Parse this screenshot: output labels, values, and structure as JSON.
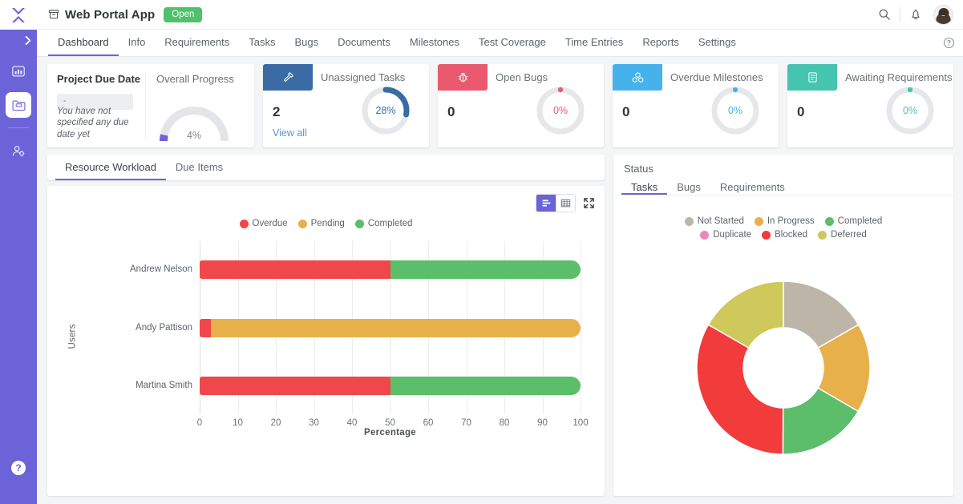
{
  "rail": {
    "logo_icon": "x-logo-icon",
    "expand_icon": "chevron-right-icon",
    "items": [
      {
        "icon": "dashboard-icon",
        "active": false
      },
      {
        "icon": "projects-folder-icon",
        "active": true
      },
      {
        "icon": "user-settings-icon",
        "active": false
      }
    ],
    "help_label": "?"
  },
  "topbar": {
    "project_icon": "archive-box-icon",
    "title": "Web Portal App",
    "status_badge": "Open",
    "search_icon": "search-icon",
    "bell_icon": "bell-icon",
    "avatar_icon": "user-avatar"
  },
  "nav": {
    "help_icon": "help-circle-icon",
    "tabs": [
      {
        "label": "Dashboard",
        "active": true
      },
      {
        "label": "Info",
        "active": false
      },
      {
        "label": "Requirements",
        "active": false
      },
      {
        "label": "Tasks",
        "active": false
      },
      {
        "label": "Bugs",
        "active": false
      },
      {
        "label": "Documents",
        "active": false
      },
      {
        "label": "Milestones",
        "active": false
      },
      {
        "label": "Test Coverage",
        "active": false
      },
      {
        "label": "Time Entries",
        "active": false
      },
      {
        "label": "Reports",
        "active": false
      },
      {
        "label": "Settings",
        "active": false
      }
    ]
  },
  "kpi": {
    "due_date": {
      "title": "Project Due Date",
      "value": "-",
      "note": "You have not specified any due date yet"
    },
    "overall_progress": {
      "title": "Overall Progress",
      "percent_label": "4%",
      "percent": 4,
      "color": "#6c63d8"
    },
    "cards": [
      {
        "label": "Unassigned Tasks",
        "value": "2",
        "link": "View all",
        "percent_label": "28%",
        "percent": 28,
        "color": "#3b6ba5",
        "icon": "hammer-icon"
      },
      {
        "label": "Open Bugs",
        "value": "0",
        "link": "",
        "percent_label": "0%",
        "percent": 0,
        "color": "#ea5a6e",
        "icon": "bug-icon"
      },
      {
        "label": "Overdue Milestones",
        "value": "0",
        "link": "",
        "percent_label": "0%",
        "percent": 0,
        "color": "#46b2ec",
        "icon": "milestone-blocks-icon"
      },
      {
        "label": "Awaiting Requirements",
        "value": "0",
        "link": "",
        "percent_label": "0%",
        "percent": 0,
        "color": "#45c4b0",
        "icon": "clipboard-list-icon"
      }
    ]
  },
  "workload": {
    "tabs": [
      {
        "label": "Resource Workload",
        "active": true
      },
      {
        "label": "Due Items",
        "active": false
      }
    ],
    "tools": {
      "chart_view_icon": "bar-chart-icon",
      "table_view_icon": "table-grid-icon",
      "fullscreen_icon": "expand-arrows-icon"
    }
  },
  "status": {
    "title": "Status",
    "tabs": [
      {
        "label": "Tasks",
        "active": true
      },
      {
        "label": "Bugs",
        "active": false
      },
      {
        "label": "Requirements",
        "active": false
      }
    ]
  },
  "chart_data": [
    {
      "type": "bar",
      "orientation": "horizontal",
      "stacked": true,
      "title": "",
      "xlabel": "Percentage",
      "ylabel": "Users",
      "xlim": [
        0,
        100
      ],
      "xticks": [
        0,
        10,
        20,
        30,
        40,
        50,
        60,
        70,
        80,
        90,
        100
      ],
      "grid": true,
      "legend_position": "top",
      "categories": [
        "Andrew Nelson",
        "Andy Pattison",
        "Martina Smith"
      ],
      "series": [
        {
          "name": "Overdue",
          "color": "#f0474b",
          "values": [
            50,
            3,
            50
          ]
        },
        {
          "name": "Pending",
          "color": "#e8b04b",
          "values": [
            0,
            97,
            0
          ]
        },
        {
          "name": "Completed",
          "color": "#5cbd6a",
          "values": [
            50,
            0,
            50
          ]
        }
      ]
    },
    {
      "type": "pie",
      "variant": "donut",
      "title": "",
      "legend_position": "top",
      "labels": [
        "Not Started",
        "In Progress",
        "Completed",
        "Duplicate",
        "Blocked",
        "Deferred"
      ],
      "colors": [
        "#bdb6a8",
        "#e8b04b",
        "#5cbd6a",
        "#ef87b5",
        "#f23b3b",
        "#cfc85a"
      ],
      "values": [
        16.7,
        16.7,
        16.7,
        0,
        33.2,
        16.7
      ]
    }
  ]
}
